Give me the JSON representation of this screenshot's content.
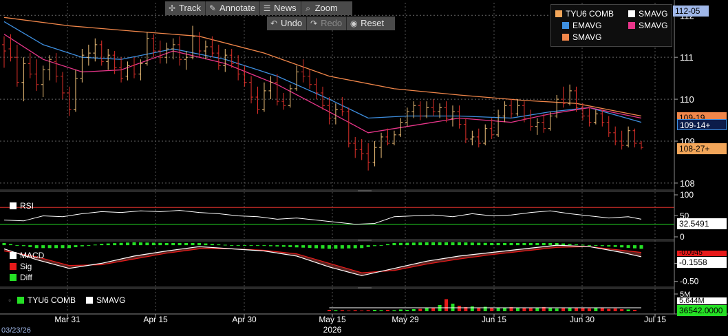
{
  "toolbar": {
    "track": "Track",
    "annotate": "Annotate",
    "news": "News",
    "zoom": "Zoom",
    "undo": "Undo",
    "redo": "Redo",
    "reset": "Reset"
  },
  "legend": {
    "items": [
      {
        "label": "TYU6 COMB",
        "color": "#f2a65a"
      },
      {
        "label": "SMAVG",
        "color": "#ffffff"
      },
      {
        "label": "EMAVG",
        "color": "#3e8fe0"
      },
      {
        "label": "SMAVG",
        "color": "#e8358a"
      },
      {
        "label": "SMAVG",
        "color": "#f0864a"
      }
    ]
  },
  "price_tags": {
    "top": "112-05",
    "sma_orange": "109-19",
    "ema_blue": "109-14+",
    "last": "108-27+"
  },
  "rsi_panel": {
    "label": "RSI",
    "value_tag": "32.5491"
  },
  "macd_panel": {
    "labels": [
      "MACD",
      "Sig",
      "Diff"
    ],
    "value_tag": "-0.1558",
    "hidden_tag": "-0.0945"
  },
  "volume_panel": {
    "labels": [
      "TYU6 COMB",
      "SMAVG"
    ],
    "tag_top": "5.644M",
    "tag_bottom": "36542.0000"
  },
  "date_start": "03/23/26",
  "chart_data": {
    "type": "line",
    "x_ticks": [
      "Mar 31",
      "Apr 15",
      "Apr 30",
      "May 15",
      "May 29",
      "Jun 15",
      "Jun 30",
      "Jul 15"
    ],
    "x_year_label": "2026",
    "price_axis": {
      "ticks": [
        108,
        109,
        110,
        111,
        112
      ],
      "tick_labels": [
        "108",
        "109",
        "110",
        "111",
        "112"
      ],
      "range": [
        107.9,
        112.3
      ]
    },
    "rsi_axis": {
      "ticks": [
        0,
        50,
        100
      ],
      "tick_labels": [
        "0",
        "50",
        "100"
      ],
      "overbought": 70,
      "oversold": 30
    },
    "macd_axis": {
      "ticks": [
        -0.5,
        -0.25
      ],
      "tick_labels": [
        "-0.50",
        "-0.25"
      ],
      "range": [
        -0.55,
        0.02
      ]
    },
    "volume_axis": {
      "ticks": [
        5
      ],
      "tick_labels": [
        "5M"
      ]
    },
    "bars": [
      {
        "o": 111.3,
        "h": 111.5,
        "l": 110.75,
        "c": 111.15
      },
      {
        "o": 111.2,
        "h": 111.55,
        "l": 110.9,
        "c": 111.0
      },
      {
        "o": 111.0,
        "h": 111.3,
        "l": 110.3,
        "c": 110.4
      },
      {
        "o": 110.4,
        "h": 111.0,
        "l": 109.95,
        "c": 110.85
      },
      {
        "o": 110.85,
        "h": 111.1,
        "l": 110.5,
        "c": 110.6
      },
      {
        "o": 110.6,
        "h": 110.95,
        "l": 110.2,
        "c": 110.35
      },
      {
        "o": 110.35,
        "h": 110.8,
        "l": 110.05,
        "c": 110.7
      },
      {
        "o": 110.7,
        "h": 111.05,
        "l": 110.45,
        "c": 110.95
      },
      {
        "o": 110.9,
        "h": 111.1,
        "l": 110.4,
        "c": 110.55
      },
      {
        "o": 110.55,
        "h": 110.65,
        "l": 110.0,
        "c": 110.15
      },
      {
        "o": 110.15,
        "h": 110.3,
        "l": 109.6,
        "c": 109.75
      },
      {
        "o": 109.75,
        "h": 110.7,
        "l": 109.7,
        "c": 110.5
      },
      {
        "o": 110.5,
        "h": 111.2,
        "l": 110.4,
        "c": 111.05
      },
      {
        "o": 111.0,
        "h": 111.3,
        "l": 110.8,
        "c": 111.1
      },
      {
        "o": 111.1,
        "h": 111.45,
        "l": 110.9,
        "c": 111.3
      },
      {
        "o": 111.3,
        "h": 111.4,
        "l": 110.8,
        "c": 110.9
      },
      {
        "o": 110.9,
        "h": 111.2,
        "l": 110.7,
        "c": 111.05
      },
      {
        "o": 111.05,
        "h": 111.15,
        "l": 110.6,
        "c": 110.75
      },
      {
        "o": 110.75,
        "h": 111.0,
        "l": 110.4,
        "c": 110.5
      },
      {
        "o": 110.55,
        "h": 110.9,
        "l": 110.45,
        "c": 110.8
      },
      {
        "o": 110.8,
        "h": 111.0,
        "l": 110.5,
        "c": 110.6
      },
      {
        "o": 110.6,
        "h": 110.95,
        "l": 110.45,
        "c": 110.85
      },
      {
        "o": 110.85,
        "h": 111.6,
        "l": 110.8,
        "c": 111.45
      },
      {
        "o": 111.45,
        "h": 111.55,
        "l": 111.0,
        "c": 111.15
      },
      {
        "o": 111.15,
        "h": 111.4,
        "l": 110.85,
        "c": 111.0
      },
      {
        "o": 111.0,
        "h": 111.35,
        "l": 110.85,
        "c": 111.2
      },
      {
        "o": 111.2,
        "h": 111.45,
        "l": 110.95,
        "c": 111.3
      },
      {
        "o": 111.3,
        "h": 111.5,
        "l": 110.8,
        "c": 110.95
      },
      {
        "o": 110.95,
        "h": 111.15,
        "l": 110.7,
        "c": 111.0
      },
      {
        "o": 111.0,
        "h": 111.75,
        "l": 110.95,
        "c": 111.5
      },
      {
        "o": 111.5,
        "h": 111.6,
        "l": 111.0,
        "c": 111.15
      },
      {
        "o": 111.15,
        "h": 111.4,
        "l": 110.95,
        "c": 111.25
      },
      {
        "o": 111.25,
        "h": 111.5,
        "l": 111.0,
        "c": 111.1
      },
      {
        "o": 111.1,
        "h": 111.3,
        "l": 110.7,
        "c": 110.8
      },
      {
        "o": 110.8,
        "h": 111.2,
        "l": 110.65,
        "c": 111.05
      },
      {
        "o": 111.05,
        "h": 111.2,
        "l": 110.75,
        "c": 110.85
      },
      {
        "o": 110.85,
        "h": 111.05,
        "l": 110.45,
        "c": 110.6
      },
      {
        "o": 110.6,
        "h": 110.8,
        "l": 110.3,
        "c": 110.4
      },
      {
        "o": 110.4,
        "h": 110.55,
        "l": 109.9,
        "c": 110.05
      },
      {
        "o": 110.05,
        "h": 110.3,
        "l": 109.65,
        "c": 109.75
      },
      {
        "o": 109.75,
        "h": 110.4,
        "l": 109.7,
        "c": 110.2
      },
      {
        "o": 110.2,
        "h": 110.55,
        "l": 110.0,
        "c": 110.4
      },
      {
        "o": 110.4,
        "h": 110.6,
        "l": 109.85,
        "c": 109.95
      },
      {
        "o": 109.95,
        "h": 110.15,
        "l": 109.75,
        "c": 109.85
      },
      {
        "o": 109.85,
        "h": 110.35,
        "l": 109.8,
        "c": 110.25
      },
      {
        "o": 110.25,
        "h": 110.8,
        "l": 110.2,
        "c": 110.65
      },
      {
        "o": 110.65,
        "h": 110.95,
        "l": 110.4,
        "c": 110.55
      },
      {
        "o": 110.55,
        "h": 110.7,
        "l": 110.25,
        "c": 110.35
      },
      {
        "o": 110.35,
        "h": 110.5,
        "l": 110.0,
        "c": 110.15
      },
      {
        "o": 110.15,
        "h": 110.3,
        "l": 109.75,
        "c": 109.85
      },
      {
        "o": 109.85,
        "h": 110.05,
        "l": 109.4,
        "c": 109.55
      },
      {
        "o": 109.55,
        "h": 109.9,
        "l": 109.4,
        "c": 109.75
      },
      {
        "o": 109.75,
        "h": 110.05,
        "l": 109.6,
        "c": 109.7
      },
      {
        "o": 109.7,
        "h": 109.8,
        "l": 108.85,
        "c": 108.95
      },
      {
        "o": 108.95,
        "h": 109.1,
        "l": 108.6,
        "c": 108.8
      },
      {
        "o": 108.8,
        "h": 109.05,
        "l": 108.55,
        "c": 108.7
      },
      {
        "o": 108.7,
        "h": 108.95,
        "l": 108.3,
        "c": 108.5
      },
      {
        "o": 108.5,
        "h": 109.0,
        "l": 108.4,
        "c": 108.85
      },
      {
        "o": 108.85,
        "h": 109.2,
        "l": 108.6,
        "c": 109.1
      },
      {
        "o": 109.1,
        "h": 109.3,
        "l": 108.9,
        "c": 108.95
      },
      {
        "o": 108.95,
        "h": 109.25,
        "l": 108.9,
        "c": 109.15
      },
      {
        "o": 109.15,
        "h": 109.55,
        "l": 109.1,
        "c": 109.45
      },
      {
        "o": 109.45,
        "h": 109.8,
        "l": 109.35,
        "c": 109.7
      },
      {
        "o": 109.7,
        "h": 109.95,
        "l": 109.55,
        "c": 109.85
      },
      {
        "o": 109.85,
        "h": 109.95,
        "l": 109.5,
        "c": 109.6
      },
      {
        "o": 109.6,
        "h": 109.95,
        "l": 109.55,
        "c": 109.8
      },
      {
        "o": 109.8,
        "h": 110.0,
        "l": 109.6,
        "c": 109.7
      },
      {
        "o": 109.7,
        "h": 109.9,
        "l": 109.55,
        "c": 109.8
      },
      {
        "o": 109.8,
        "h": 109.95,
        "l": 109.45,
        "c": 109.55
      },
      {
        "o": 109.55,
        "h": 109.85,
        "l": 109.35,
        "c": 109.7
      },
      {
        "o": 109.7,
        "h": 109.85,
        "l": 109.3,
        "c": 109.4
      },
      {
        "o": 109.4,
        "h": 109.55,
        "l": 108.95,
        "c": 109.05
      },
      {
        "o": 109.05,
        "h": 109.25,
        "l": 108.9,
        "c": 109.1
      },
      {
        "o": 109.1,
        "h": 109.3,
        "l": 108.85,
        "c": 108.95
      },
      {
        "o": 108.95,
        "h": 109.4,
        "l": 108.9,
        "c": 109.3
      },
      {
        "o": 109.3,
        "h": 109.55,
        "l": 109.05,
        "c": 109.15
      },
      {
        "o": 109.15,
        "h": 109.75,
        "l": 109.1,
        "c": 109.6
      },
      {
        "o": 109.6,
        "h": 109.95,
        "l": 109.45,
        "c": 109.85
      },
      {
        "o": 109.85,
        "h": 110.0,
        "l": 109.55,
        "c": 109.65
      },
      {
        "o": 109.65,
        "h": 110.0,
        "l": 109.6,
        "c": 109.85
      },
      {
        "o": 109.85,
        "h": 109.95,
        "l": 109.45,
        "c": 109.55
      },
      {
        "o": 109.55,
        "h": 109.75,
        "l": 109.25,
        "c": 109.35
      },
      {
        "o": 109.35,
        "h": 109.55,
        "l": 109.15,
        "c": 109.45
      },
      {
        "o": 109.45,
        "h": 109.65,
        "l": 109.2,
        "c": 109.3
      },
      {
        "o": 109.3,
        "h": 109.7,
        "l": 109.25,
        "c": 109.6
      },
      {
        "o": 109.6,
        "h": 110.1,
        "l": 109.55,
        "c": 110.0
      },
      {
        "o": 110.0,
        "h": 110.3,
        "l": 109.8,
        "c": 109.9
      },
      {
        "o": 109.9,
        "h": 110.35,
        "l": 109.85,
        "c": 110.2
      },
      {
        "o": 110.2,
        "h": 110.3,
        "l": 109.7,
        "c": 109.8
      },
      {
        "o": 109.8,
        "h": 109.9,
        "l": 109.5,
        "c": 109.6
      },
      {
        "o": 109.6,
        "h": 109.8,
        "l": 109.35,
        "c": 109.45
      },
      {
        "o": 109.45,
        "h": 109.75,
        "l": 109.4,
        "c": 109.65
      },
      {
        "o": 109.65,
        "h": 109.75,
        "l": 109.35,
        "c": 109.45
      },
      {
        "o": 109.45,
        "h": 109.6,
        "l": 109.1,
        "c": 109.2
      },
      {
        "o": 109.2,
        "h": 109.35,
        "l": 108.9,
        "c": 109.0
      },
      {
        "o": 109.0,
        "h": 109.25,
        "l": 108.8,
        "c": 108.9
      },
      {
        "o": 108.9,
        "h": 109.35,
        "l": 108.85,
        "c": 109.25
      },
      {
        "o": 109.25,
        "h": 109.3,
        "l": 108.85,
        "c": 108.95
      },
      {
        "o": 108.95,
        "h": 109.0,
        "l": 108.8,
        "c": 108.85
      }
    ],
    "series": [
      {
        "name": "SMAVG",
        "color": "#f0864a",
        "x": [
          0,
          10,
          20,
          30,
          40,
          50,
          60,
          70,
          80,
          88,
          98
        ],
        "y": [
          111.95,
          111.75,
          111.62,
          111.5,
          111.1,
          110.55,
          110.25,
          110.1,
          109.97,
          109.9,
          109.6
        ]
      },
      {
        "name": "EMAVG",
        "color": "#3e8fe0",
        "x": [
          0,
          6,
          12,
          18,
          26,
          34,
          42,
          50,
          56,
          62,
          70,
          78,
          84,
          90,
          98
        ],
        "y": [
          111.85,
          111.3,
          111.0,
          110.95,
          111.2,
          110.95,
          110.55,
          110.0,
          109.55,
          109.6,
          109.6,
          109.55,
          109.7,
          109.8,
          109.45
        ]
      },
      {
        "name": "SMAVG",
        "color": "#e8358a",
        "x": [
          0,
          6,
          12,
          18,
          26,
          34,
          42,
          50,
          56,
          62,
          70,
          78,
          84,
          90,
          98
        ],
        "y": [
          111.55,
          110.95,
          110.65,
          110.7,
          111.15,
          110.85,
          110.35,
          109.7,
          109.2,
          109.35,
          109.55,
          109.45,
          109.65,
          109.8,
          109.55
        ]
      }
    ],
    "rsi": {
      "x": [
        0,
        3,
        6,
        9,
        12,
        15,
        18,
        21,
        24,
        27,
        30,
        33,
        36,
        39,
        42,
        45,
        48,
        51,
        54,
        57,
        60,
        63,
        66,
        69,
        72,
        75,
        78,
        81,
        84,
        87,
        90,
        93,
        96,
        98
      ],
      "y": [
        40,
        38,
        50,
        48,
        55,
        60,
        58,
        62,
        60,
        63,
        58,
        55,
        50,
        48,
        42,
        45,
        40,
        35,
        30,
        32,
        48,
        50,
        52,
        48,
        55,
        50,
        52,
        58,
        62,
        55,
        50,
        45,
        48,
        42
      ]
    },
    "macd": {
      "x": [
        0,
        5,
        10,
        15,
        20,
        25,
        30,
        35,
        40,
        45,
        50,
        55,
        60,
        65,
        70,
        75,
        80,
        85,
        90,
        95,
        98
      ],
      "macd": [
        -0.05,
        -0.2,
        -0.32,
        -0.25,
        -0.15,
        -0.08,
        -0.02,
        -0.05,
        -0.08,
        -0.15,
        -0.3,
        -0.42,
        -0.32,
        -0.22,
        -0.15,
        -0.1,
        -0.05,
        0.0,
        -0.02,
        -0.1,
        -0.16
      ],
      "sig": [
        -0.08,
        -0.16,
        -0.28,
        -0.27,
        -0.19,
        -0.11,
        -0.05,
        -0.05,
        -0.07,
        -0.12,
        -0.25,
        -0.38,
        -0.35,
        -0.26,
        -0.19,
        -0.13,
        -0.08,
        -0.03,
        -0.02,
        -0.07,
        -0.1
      ],
      "diff": [
        0.03,
        -0.04,
        -0.04,
        0.02,
        0.04,
        0.03,
        0.03,
        0.0,
        -0.01,
        -0.03,
        -0.05,
        -0.04,
        0.03,
        0.04,
        0.04,
        0.03,
        0.03,
        0.03,
        0.0,
        -0.03,
        -0.05
      ]
    },
    "volume_m": [
      0.4,
      0.3,
      0.3,
      0.2,
      0.3,
      0.2,
      0.3,
      0.4,
      0.3,
      0.4,
      0.3,
      0.5,
      0.4,
      0.6,
      0.7,
      0.9,
      1.1,
      1.8,
      3.5,
      2.2,
      1.6,
      1.2,
      1.4,
      1.0,
      1.3,
      1.1,
      0.9,
      1.0,
      1.2,
      0.9,
      1.1,
      1.0,
      0.9,
      1.2,
      1.0,
      0.8,
      1.1,
      1.0,
      0.9,
      1.0,
      0.8,
      0.9,
      1.0,
      0.7,
      0.8,
      0.6,
      0.5,
      0.4
    ],
    "volume_start_bar": 50
  }
}
